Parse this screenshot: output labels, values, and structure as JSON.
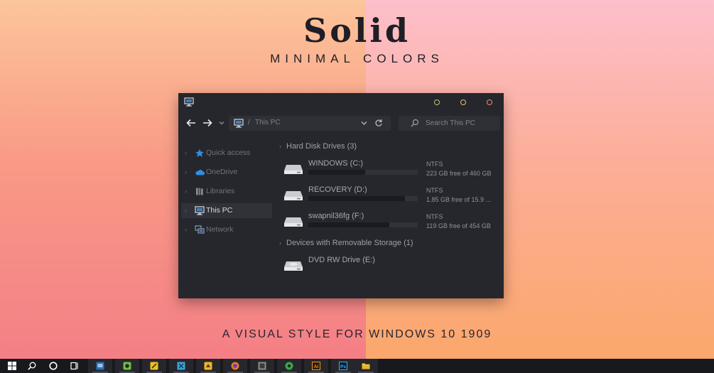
{
  "hero": {
    "title": "Solid",
    "subtitle": "MINIMAL COLORS",
    "footer": "A VISUAL STYLE FOR WINDOWS 10 1909"
  },
  "window": {
    "titlebar": {
      "icon": "this-pc-icon",
      "buttons": [
        {
          "name": "minimize",
          "color": "#b5cc6d"
        },
        {
          "name": "maximize",
          "color": "#e9c063"
        },
        {
          "name": "close",
          "color": "#ef8d78"
        }
      ]
    },
    "address": {
      "separator": "/",
      "path": "This PC"
    },
    "search": {
      "placeholder": "Search This PC"
    },
    "sidebar": {
      "items": [
        {
          "label": "Quick access",
          "icon": "star-icon",
          "icon_color": "#2f8fe0"
        },
        {
          "label": "OneDrive",
          "icon": "cloud-icon",
          "icon_color": "#2f8fe0"
        },
        {
          "label": "Libraries",
          "icon": "libraries-icon",
          "icon_color": "#8a8f96"
        },
        {
          "label": "This PC",
          "icon": "this-pc-icon",
          "icon_color": "#b8c4d2",
          "active": true
        },
        {
          "label": "Network",
          "icon": "network-icon",
          "icon_color": "#8a9ab0"
        }
      ]
    },
    "groups": [
      {
        "label": "Hard Disk Drives (3)"
      },
      {
        "label": "Devices with Removable Storage (1)"
      }
    ],
    "drives": [
      {
        "name": "WINDOWS (C:)",
        "fs": "NTFS",
        "free": "223 GB free of 460 GB",
        "used_fraction": 0.52
      },
      {
        "name": "RECOVERY (D:)",
        "fs": "NTFS",
        "free": "1.85 GB free of 15.9 ...",
        "used_fraction": 0.88
      },
      {
        "name": "swapnil36fg (F:)",
        "fs": "NTFS",
        "free": "119 GB free of 454 GB",
        "used_fraction": 0.74
      }
    ],
    "removable": [
      {
        "name": "DVD RW Drive (E:)"
      }
    ]
  },
  "taskbar": {
    "items": [
      {
        "name": "start",
        "icon": "windows-logo-icon"
      },
      {
        "name": "search",
        "icon": "search-icon"
      },
      {
        "name": "cortana",
        "icon": "cortana-ring-icon"
      },
      {
        "name": "task-view",
        "icon": "task-view-icon"
      },
      {
        "name": "app-1",
        "icon": "blue-app-icon",
        "color": "#2d6fb5"
      },
      {
        "name": "app-2",
        "icon": "green-app-icon",
        "color": "#6bbf45"
      },
      {
        "name": "app-3",
        "icon": "yellow-app-icon",
        "color": "#e9c321"
      },
      {
        "name": "app-4",
        "icon": "cyan-app-icon",
        "color": "#3ba3d8"
      },
      {
        "name": "app-5",
        "icon": "orange-folder-app-icon",
        "color": "#f0b429"
      },
      {
        "name": "app-6",
        "icon": "firefox-icon",
        "color": "#e67a28"
      },
      {
        "name": "app-7",
        "icon": "gray-app-icon",
        "color": "#8b8e86"
      },
      {
        "name": "app-8",
        "icon": "green-circle-app-icon",
        "color": "#3ca84b"
      },
      {
        "name": "app-9",
        "icon": "illustrator-icon",
        "color": "#f29325",
        "label": "Ai"
      },
      {
        "name": "app-10",
        "icon": "photoshop-icon",
        "color": "#3db0f0",
        "label": "Ps"
      },
      {
        "name": "app-11",
        "icon": "file-explorer-icon",
        "color": "#f5c542"
      }
    ]
  }
}
